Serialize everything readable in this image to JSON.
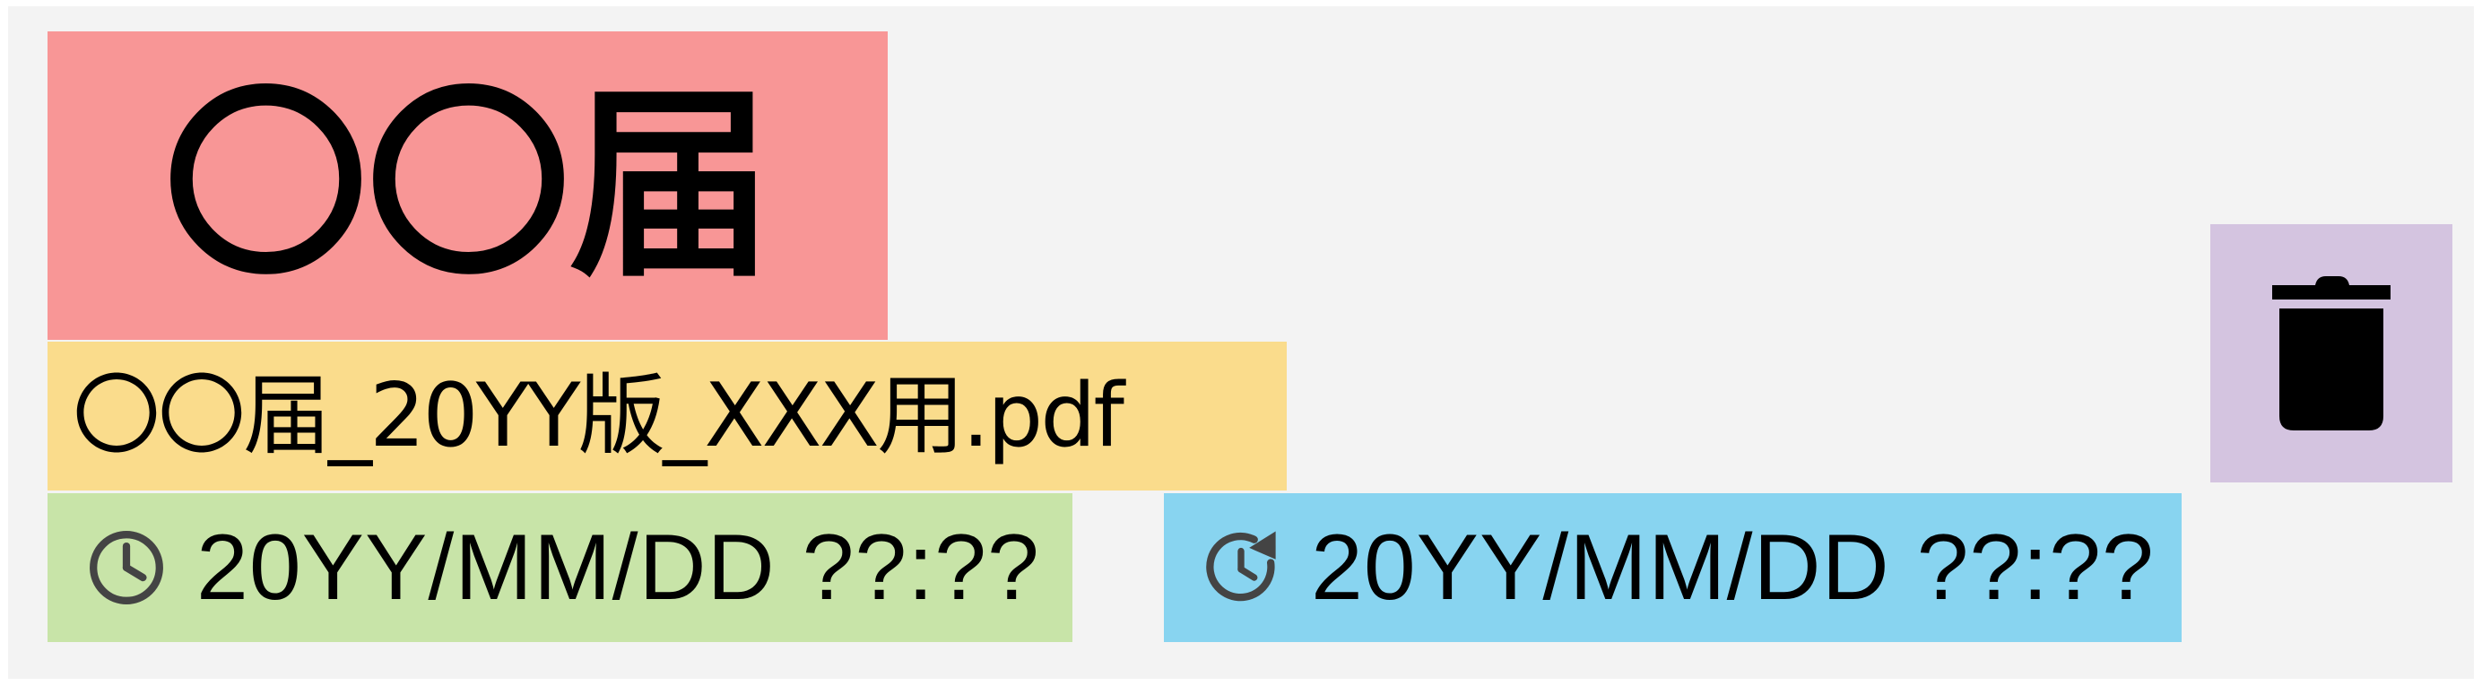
{
  "item": {
    "title": "〇〇届",
    "file_name": "〇〇届_20YY版_XXX用.pdf",
    "created_at": "20YY/MM/DD ??:??",
    "updated_at": "20YY/MM/DD ??:??"
  },
  "icons": {
    "created": "clock-icon",
    "updated": "clock-refresh-icon",
    "delete": "trash-icon"
  },
  "colors": {
    "card_background": "#f3f3f3",
    "title_background": "#f89696",
    "file_background": "#fadc8c",
    "created_background": "#c8e4a8",
    "updated_background": "#88d4f0",
    "delete_background": "#d4c4e0",
    "icon_color": "#444444"
  }
}
